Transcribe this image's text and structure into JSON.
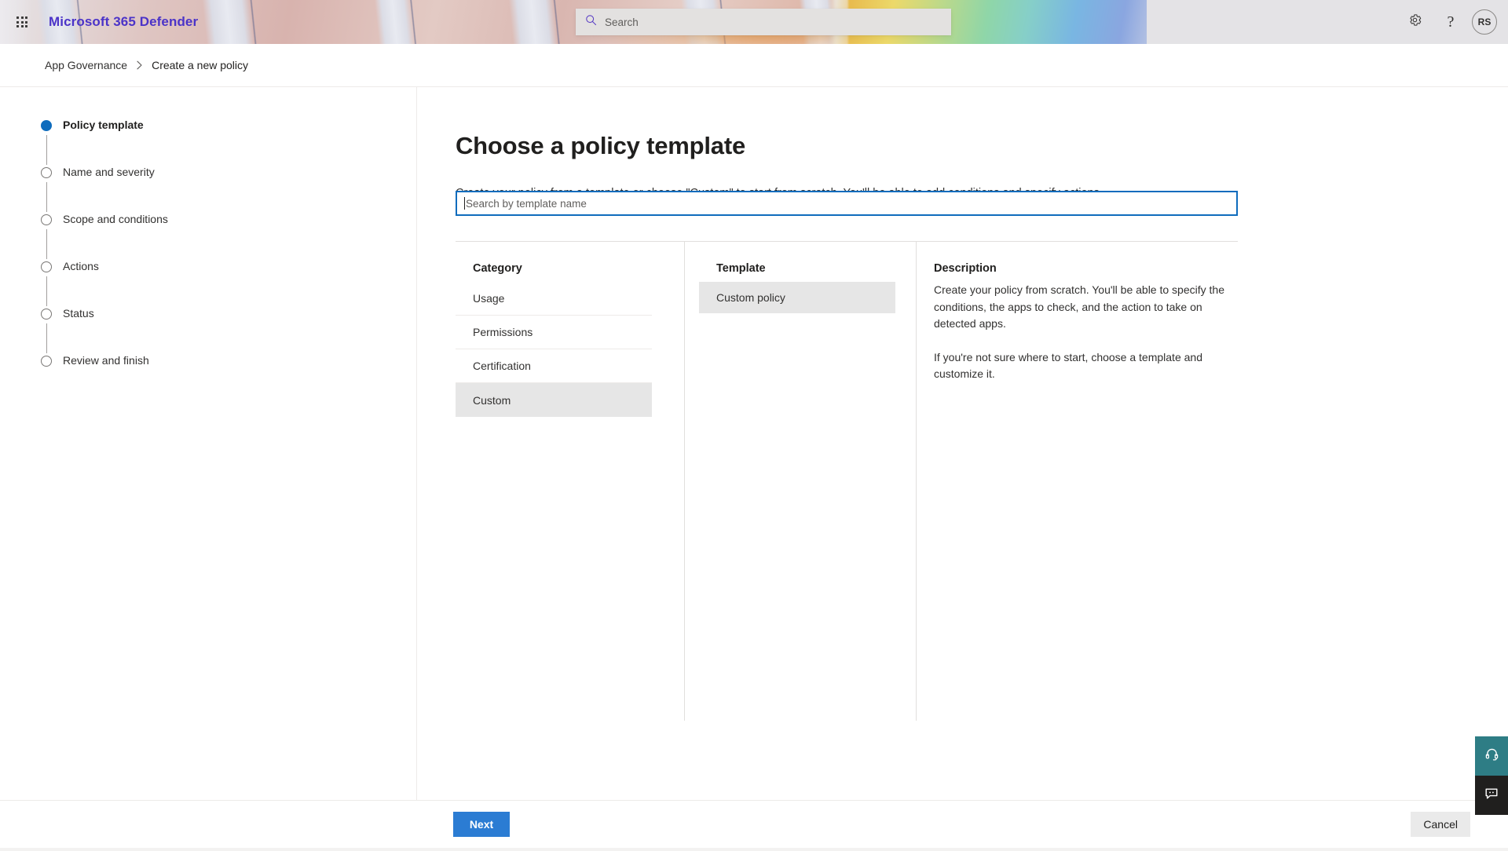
{
  "header": {
    "brand": "Microsoft 365 Defender",
    "waffle_label": "App launcher",
    "search_placeholder": "Search",
    "settings_label": "Settings",
    "help_label": "Help",
    "avatar_initials": "RS",
    "accent_brand_color": "#4b33c8"
  },
  "breadcrumb": {
    "parent": "App Governance",
    "separator": "›",
    "current": "Create a new policy"
  },
  "stepper": {
    "steps": [
      {
        "label": "Policy template",
        "state": "active"
      },
      {
        "label": "Name and severity",
        "state": "pending"
      },
      {
        "label": "Scope and conditions",
        "state": "pending"
      },
      {
        "label": "Actions",
        "state": "pending"
      },
      {
        "label": "Status",
        "state": "pending"
      },
      {
        "label": "Review and finish",
        "state": "pending"
      }
    ],
    "active_color": "#0f6cbd"
  },
  "main": {
    "title": "Choose a policy template",
    "subtitle": "Create your policy from a template or choose \"Custom\" to start from scratch. You'll be able to add conditions and specify actions.",
    "template_search": {
      "placeholder": "Search by template name",
      "value": "",
      "focused": true,
      "focus_color": "#0f6cbd"
    },
    "category": {
      "heading": "Category",
      "items": [
        {
          "label": "Usage",
          "selected": false
        },
        {
          "label": "Permissions",
          "selected": false
        },
        {
          "label": "Certification",
          "selected": false
        },
        {
          "label": "Custom",
          "selected": true
        }
      ]
    },
    "template": {
      "heading": "Template",
      "items": [
        {
          "label": "Custom policy",
          "selected": true
        }
      ]
    },
    "description": {
      "heading": "Description",
      "paragraphs": [
        "Create your policy from scratch. You'll be able to specify the conditions, the apps to check, and the action to take on detected apps.",
        "If you're not sure where to start, choose a template and customize it."
      ]
    }
  },
  "footer": {
    "next_label": "Next",
    "cancel_label": "Cancel",
    "primary_color": "#2b7cd3"
  },
  "side_dock": {
    "support_label": "Support",
    "feedback_label": "Feedback",
    "support_color": "#2e7d85",
    "feedback_color": "#201f1e"
  }
}
